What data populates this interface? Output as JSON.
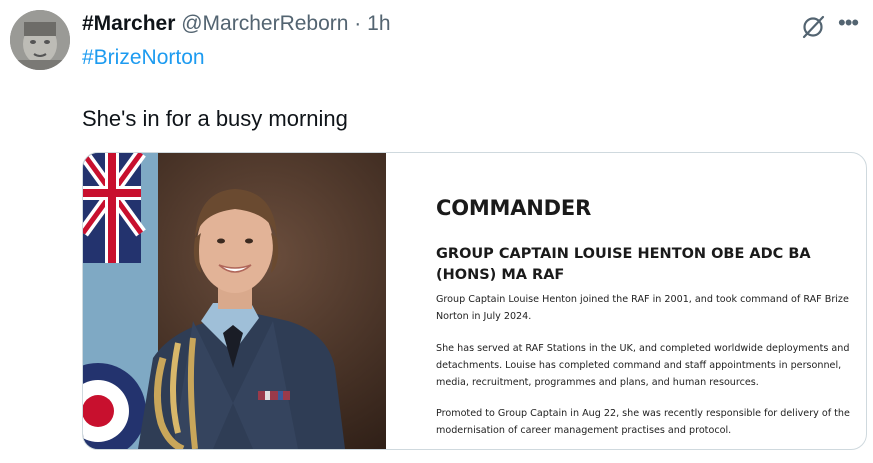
{
  "tweet": {
    "display_name": "#Marcher",
    "handle": "@MarcherReborn",
    "separator": "·",
    "time": "1h",
    "hashtag": "#BrizeNorton",
    "text": "She's in for a busy morning"
  },
  "icons": {
    "avatar": "profile-avatar",
    "grok": "grok-slash-icon",
    "more": "more-dots-icon"
  },
  "more_glyph": "•••",
  "card": {
    "title": "COMMANDER",
    "subtitle": "GROUP CAPTAIN LOUISE HENTON OBE ADC BA (HONS) MA RAF",
    "paragraphs": [
      "Group Captain Louise Henton joined the RAF in 2001, and took command of RAF Brize Norton in July 2024.",
      "She has served at RAF Stations in the UK, and completed worldwide deployments and detachments. Louise has completed command and staff appointments in personnel, media, recruitment, programmes and plans, and human resources.",
      "Promoted to Group Captain in Aug 22, she was recently responsible for delivery of the modernisation of career management practises and protocol."
    ]
  },
  "colors": {
    "link": "#1d9bf0",
    "secondary_text": "#536471",
    "border": "#cfd9de"
  }
}
